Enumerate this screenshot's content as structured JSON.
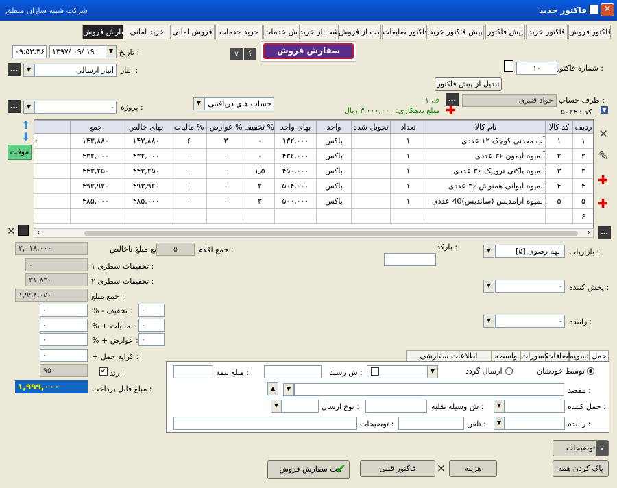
{
  "window": {
    "app_name": "شرکت شبیه سازان منطق",
    "title": "فاکتور جدید"
  },
  "tabs": [
    "فاکتور فروش",
    "فاکتور خرید",
    "پیش فاکتور",
    "پیش فاکتور خرید",
    "فاکتور ضایعات",
    "برگشت از فروش",
    "برگشت از خرید",
    "فروش خدمات",
    "خرید خدمات",
    "فروش امانی",
    "خرید امانی",
    "سفارش فروش"
  ],
  "header": {
    "invoice_number_label": "شماره فاکتور :",
    "invoice_number": "۱۰",
    "convert_button": "تبدیل از پیش فاکتور",
    "order_type_button": "سفارش فروش",
    "date_label": "تاریخ :",
    "date": "۱۳۹۷/ ۰۹/ ۱۹",
    "time": "۰۹:۵۳:۳۶",
    "warehouse_label": "انبار :",
    "warehouse": "انبار ارسالی",
    "account_label": "طرف حساب :",
    "account": "جواد قنبری",
    "account_badge": "۱ ف",
    "code": "کد : ۵۰۲۴",
    "debt_text": "مبلغ بدهکاری: ۳,۰۰۰,۰۰۰ ریال",
    "cash_account": "حساب های دریافتنی",
    "project_label": "پروژه :",
    "project": "-",
    "temp_label": "موقت",
    "nav_v": "v",
    "nav_q": "؟"
  },
  "table": {
    "columns": [
      "ردیف",
      "کد کالا",
      "نام کالا",
      "تعداد",
      "تحویل شده",
      "واحد",
      "بهای واحد",
      "% تخفیف",
      "% عوارض",
      "% مالیات",
      "بهای خالص",
      "جمع"
    ],
    "overflow_cell": "تحویل",
    "rows": [
      [
        "۱",
        "۱",
        "آب معدنی کوچک ۱۲ عددی",
        "۱",
        "",
        "باکس",
        "۱۳۲,۰۰۰",
        "۰",
        "۳",
        "۶",
        "۱۴۳,۸۸۰",
        "۱۴۳,۸۸۰"
      ],
      [
        "۲",
        "۲",
        "آبمیوه لیمون ۳۶ عددی",
        "۱",
        "",
        "باکس",
        "۴۳۲,۰۰۰",
        "۰",
        "۰",
        "۰",
        "۴۳۲,۰۰۰",
        "۴۳۲,۰۰۰"
      ],
      [
        "۳",
        "۳",
        "آبمیوه پاکتی تروپیک ۳۶ عددی",
        "۱",
        "",
        "باکس",
        "۴۵۰,۰۰۰",
        "۱٫۵",
        "۰",
        "۰",
        "۴۴۳,۲۵۰",
        "۴۴۳,۲۵۰"
      ],
      [
        "۴",
        "۴",
        "آبمیوه لیوانی همنوش ۳۶ عددی",
        "۱",
        "",
        "باکس",
        "۵۰۴,۰۰۰",
        "۲",
        "۰",
        "۰",
        "۴۹۳,۹۲۰",
        "۴۹۳,۹۲۰"
      ],
      [
        "۵",
        "۵",
        "آبمیوه آرامدیس (ساندیس)40 عددی",
        "۱",
        "",
        "باکس",
        "۵۰۰,۰۰۰",
        "۳",
        "۰",
        "۰",
        "۴۸۵,۰۰۰",
        "۴۸۵,۰۰۰"
      ],
      [
        "۶",
        "",
        "",
        "",
        "",
        "",
        "",
        "",
        "",
        "",
        "",
        ""
      ]
    ]
  },
  "totals": {
    "gross_label": "جمع مبلغ ناخالص :",
    "gross": "۲,۰۱۸,۰۰۰",
    "items_label": "جمع اقلام :",
    "items": "۵",
    "line_disc1_label": "تخفیفات سطری ۱ :",
    "line_disc1": "۰",
    "line_disc2_label": "تخفیفات سطری ۲ :",
    "line_disc2": "۳۱,۸۳۰",
    "sum_label": "جمع مبلغ :",
    "sum": "۱,۹۹۸,۰۵۰",
    "discount_label": "% - تخفیف :",
    "discount_val": "۰",
    "discount_pct": "۰",
    "tax_label": "% + مالیات :",
    "tax_val": "۰",
    "tax_pct": "۰",
    "duty_label": "% + عوارض :",
    "duty_val": "۰",
    "duty_pct": "۰",
    "freight_label": "+ کرایه حمل :",
    "freight": "۰",
    "round_label": "رند :",
    "round": "۹۵۰",
    "payable_label": "مبلغ قابل پرداخت :",
    "payable": "۱,۹۹۹,۰۰۰"
  },
  "right_fields": {
    "barcode_label": "بارکد :",
    "marketer_label": "بازاریاب :",
    "marketer": "الهه رضوی [۵]",
    "distributor_label": "پخش کننده :",
    "distributor": "-",
    "driver_label": "راننده :",
    "driver": "-"
  },
  "panel_tabs": [
    "حمل",
    "تسویه",
    "اضافات",
    "کسورات",
    "واسطه",
    "اطلاعات سفارشی"
  ],
  "shipping": {
    "self_label": "توسط خودشان",
    "courier_label": "ارسال گردد",
    "receipt_label": "ش رسید :",
    "insurance_label": "مبلغ بیمه :",
    "destination_label": "مقصد :",
    "carrier_label": "حمل کننده :",
    "vehicle_label": "ش وسیله نقلیه :",
    "send_type_label": "نوع ارسال :",
    "driver_label": "راننده :",
    "phone_label": "تلفن :",
    "notes_label": "توضیحات :"
  },
  "footer": {
    "notes_button": "توضیحات",
    "clear_all": "پاک کردن همه",
    "cost": "هزینه",
    "previous_invoice": "فاکتور قبلی",
    "save_order": "ثبت سفارش فروش",
    "v": "v"
  },
  "colors": {
    "titlebar": "#0b4fc8",
    "payable_bg": "#1166c4",
    "payable_fg": "#f6f000",
    "debt": "#118800",
    "order_btn": "#5a2b8a"
  }
}
